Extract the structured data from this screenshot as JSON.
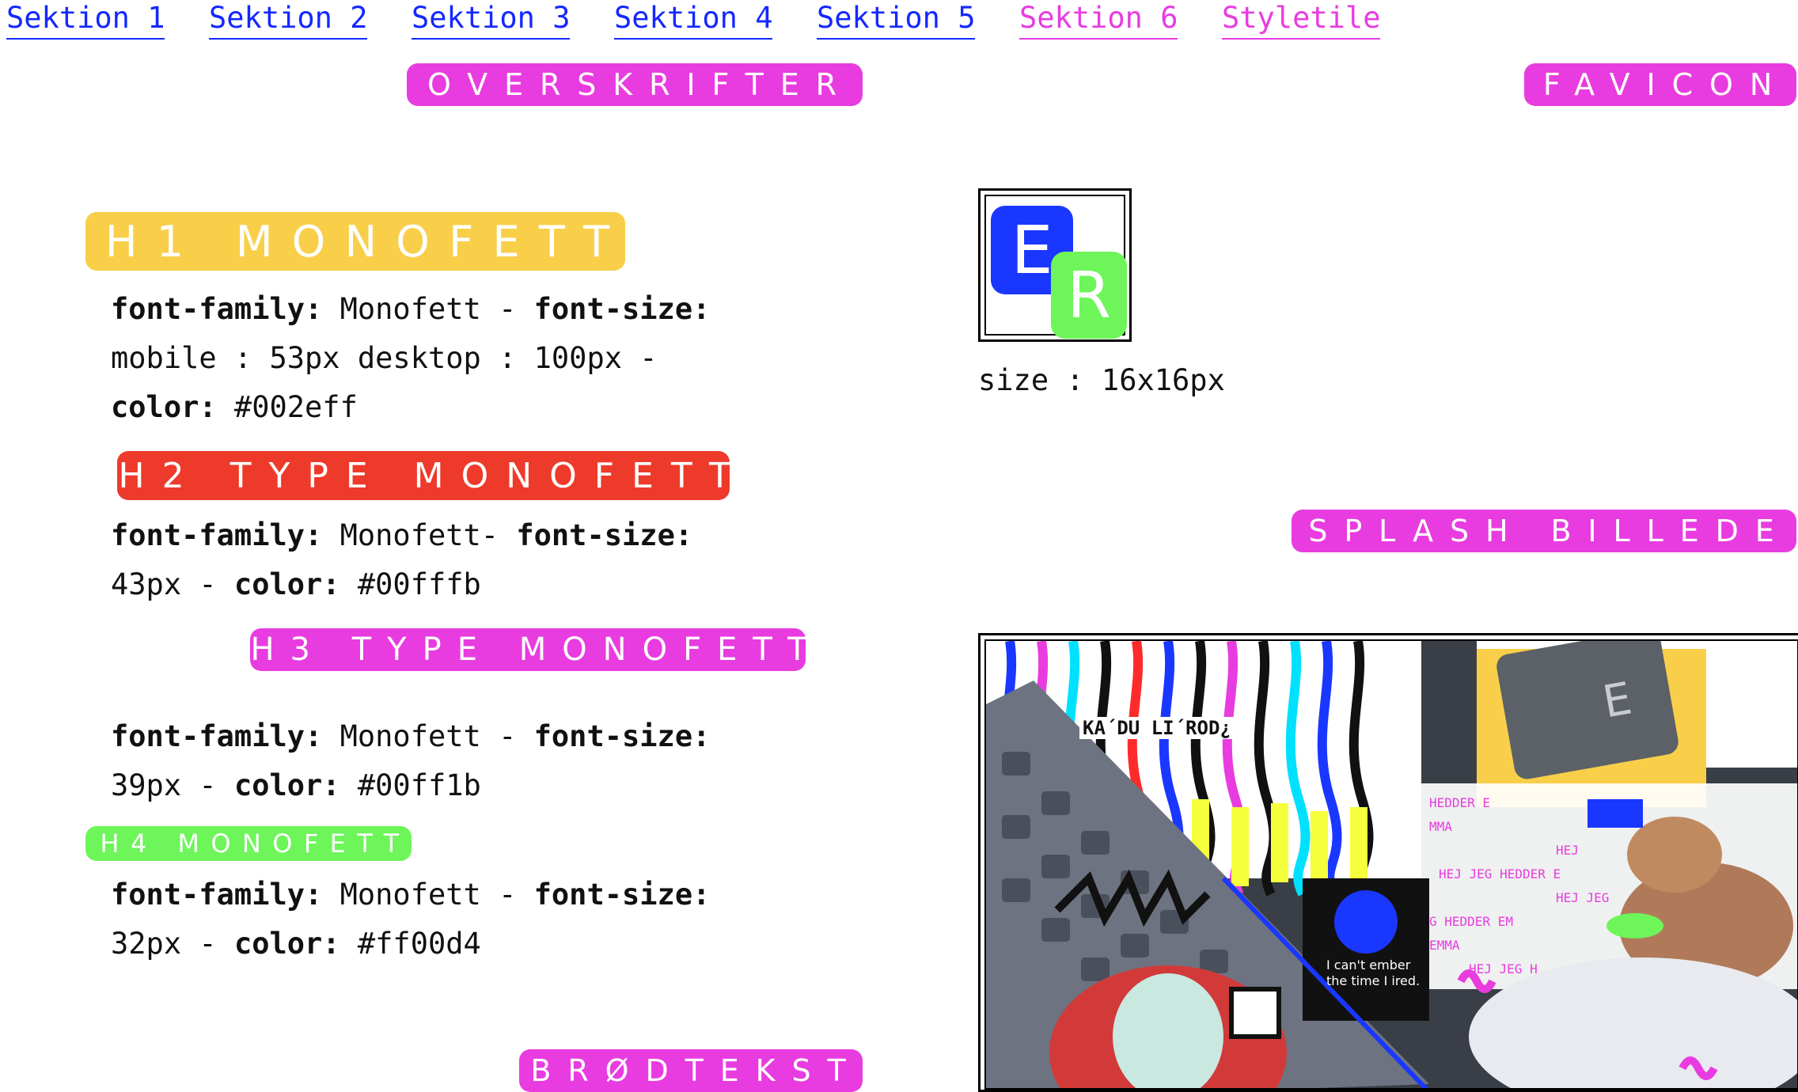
{
  "nav": {
    "items": [
      {
        "label": "Sektion 1",
        "visited": false
      },
      {
        "label": "Sektion 2",
        "visited": false
      },
      {
        "label": "Sektion 3",
        "visited": false
      },
      {
        "label": "Sektion 4",
        "visited": false
      },
      {
        "label": "Sektion 5",
        "visited": false
      },
      {
        "label": "Sektion 6",
        "visited": true
      },
      {
        "label": "Styletile",
        "visited": true
      }
    ]
  },
  "section_labels": {
    "overskrifter": "OVERSKRIFTER",
    "favicon": "FAVICON",
    "splash": "SPLASH BILLEDE",
    "brodtekst": "BRØDTEKST"
  },
  "headings": {
    "h1": {
      "title": "H1 MONOFETT",
      "line1_key1": "font-family:",
      "line1_val1": " Monofett - ",
      "line1_key2": "font-size:",
      "line2": "mobile : 53px desktop : 100px -",
      "line3_key": "color:",
      "line3_val": " #002eff"
    },
    "h2": {
      "title": "H2 TYPE MONOFETT",
      "line1_key1": "font-family:",
      "line1_val1": " Monofett- ",
      "line1_key2": "font-size:",
      "line2_val": "43px - ",
      "line2_key": "color:",
      "line2_val2": " #00fffb"
    },
    "h3": {
      "title": "H3 TYPE MONOFETT",
      "line1_key1": "font-family:",
      "line1_val1": " Monofett - ",
      "line1_key2": "font-size:",
      "line2_val": "39px - ",
      "line2_key": "color:",
      "line2_val2": " #00ff1b"
    },
    "h4": {
      "title": "H4 MONOFETT",
      "line1_key1": "font-family:",
      "line1_val1": " Monofett - ",
      "line1_key2": "font-size:",
      "line2_val": "32px - ",
      "line2_key": "color:",
      "line2_val2": " #ff00d4"
    }
  },
  "favicon": {
    "letter1": "E",
    "letter2": "R",
    "size_text": "size : 16x16px"
  },
  "splash": {
    "caption_text": "KA´DU LI´ROD¿",
    "sun_caption": "I can't ember the time I ired.",
    "collage_texts": [
      "HEDDER E",
      "MMA",
      "HEJ",
      "HEJ JEG HEDDER E",
      "HEJ JEG",
      "G HEDDER EM",
      "EMMA",
      "HEJ JEG H"
    ],
    "key_letter": "E"
  },
  "colors": {
    "nav_link": "#1428ff",
    "nav_visited": "#e83ce0",
    "label_pink": "#e83ce0",
    "h1_tile": "#f9cf4a",
    "h2_tile": "#ee3a2a",
    "h3_tile": "#e83ce0",
    "h4_tile": "#6df55a",
    "favicon_blue": "#1a37ff",
    "favicon_green": "#6df55a"
  }
}
